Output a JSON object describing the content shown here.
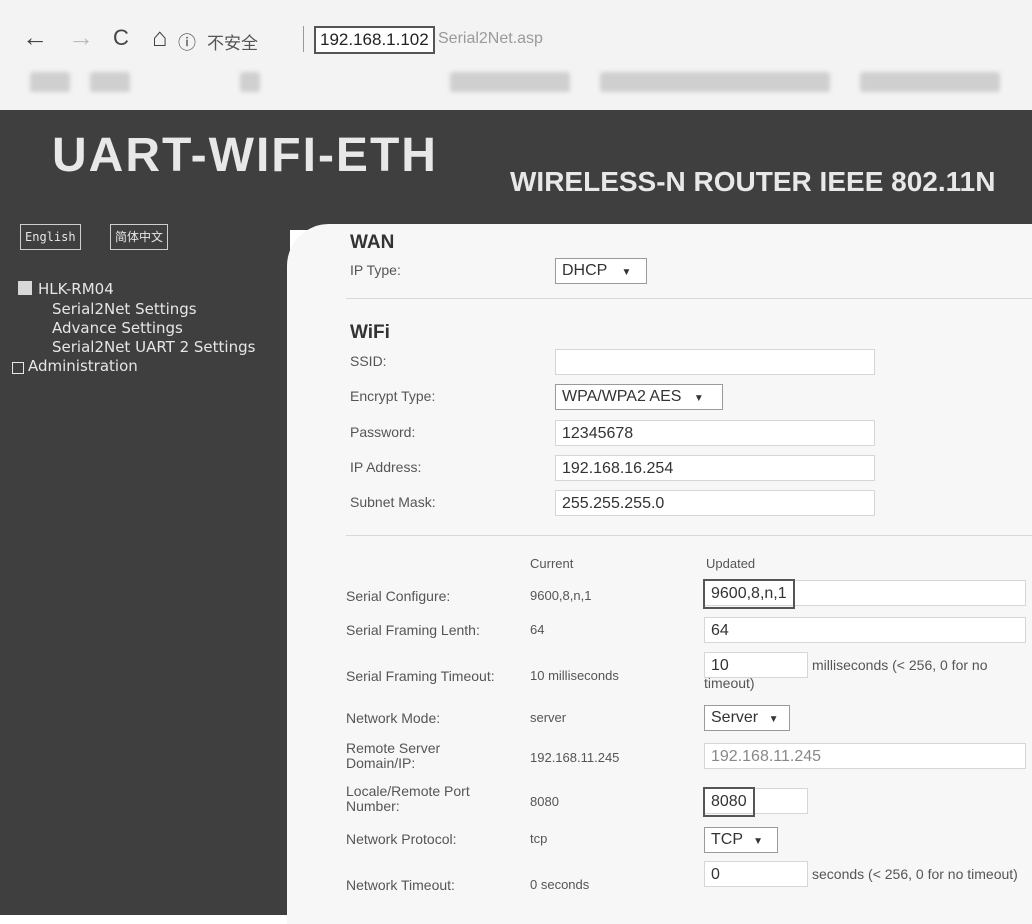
{
  "browser": {
    "back_icon": "←",
    "forward_icon": "→",
    "reload_icon": "C",
    "home_icon": "⌂",
    "info_icon": "ⓘ",
    "security_text": "不安全",
    "url_host": "192.168.1.102",
    "url_path": "Serial2Net.asp"
  },
  "header": {
    "logo": "UART-WIFI-ETH",
    "subtitle": "WIRELESS-N ROUTER IEEE 802.11N"
  },
  "sidebar": {
    "lang_english": "English",
    "lang_chinese": "简体中文",
    "device": "HLK-RM04",
    "items": [
      "Serial2Net Settings",
      "Advance Settings",
      "Serial2Net UART 2 Settings"
    ],
    "admin": "Administration"
  },
  "wan": {
    "title": "WAN",
    "ip_type_label": "IP Type:",
    "ip_type_value": "DHCP",
    "select_arrow": "▼"
  },
  "wifi": {
    "title": "WiFi",
    "ssid_label": "SSID:",
    "ssid_value": "",
    "encrypt_label": "Encrypt Type:",
    "encrypt_value": "WPA/WPA2 AES",
    "password_label": "Password:",
    "password_value": "12345678",
    "ip_label": "IP Address:",
    "ip_value": "192.168.16.254",
    "mask_label": "Subnet Mask:",
    "mask_value": "255.255.255.0"
  },
  "serial": {
    "col_current": "Current",
    "col_updated": "Updated",
    "rows": [
      {
        "label": "Serial Configure:",
        "current": "9600,8,n,1",
        "updated": "9600,8,n,1"
      },
      {
        "label": "Serial Framing Lenth:",
        "current": "64",
        "updated": "64"
      },
      {
        "label": "Serial Framing Timeout:",
        "current": "10 milliseconds",
        "updated": "10",
        "note": "milliseconds (< 256, 0 for no timeout)"
      },
      {
        "label": "Network Mode:",
        "current": "server",
        "updated": "Server"
      },
      {
        "label": "Remote Server Domain/IP:",
        "current": "192.168.11.245",
        "updated": "192.168.11.245"
      },
      {
        "label": "Locale/Remote Port Number:",
        "current": "8080",
        "updated": "8080"
      },
      {
        "label": "Network Protocol:",
        "current": "tcp",
        "updated": "TCP"
      },
      {
        "label": "Network Timeout:",
        "current": "0 seconds",
        "updated": "0",
        "note": "seconds (< 256, 0 for no timeout)"
      }
    ]
  }
}
